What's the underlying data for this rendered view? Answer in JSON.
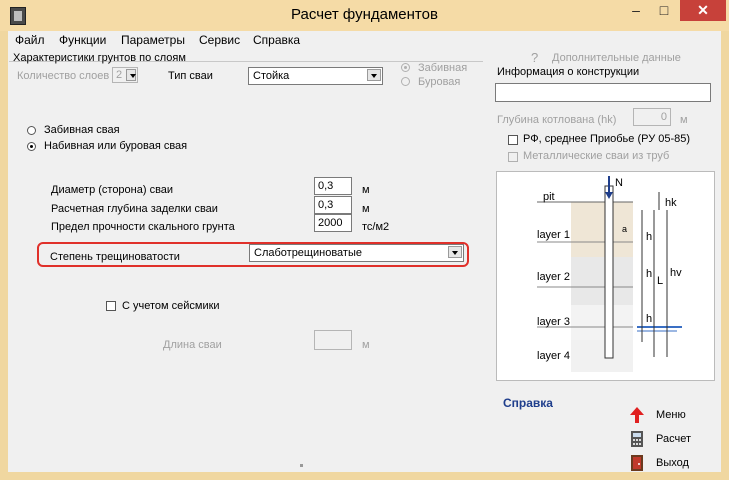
{
  "window": {
    "title": "Расчет фундаментов",
    "min_glyph": "–",
    "max_glyph": "□",
    "close_glyph": "✕"
  },
  "menu": [
    "Файл",
    "Функции",
    "Параметры",
    "Сервис",
    "Справка"
  ],
  "soil": {
    "group_title": "Характеристики грунтов по слоям",
    "layers_label": "Количество слоев",
    "layers_value": "2",
    "pile_type_label": "Тип сваи",
    "pile_type_value": "Стойка",
    "opt_driven": "Забивная",
    "opt_bored": "Буровая"
  },
  "pile_kind": {
    "driven": "Забивная свая",
    "bored": "Набивная или буровая свая"
  },
  "params": {
    "diameter_label": "Диаметр (сторона) сваи",
    "diameter_value": "0,3",
    "diameter_unit": "м",
    "depth_label": "Расчетная глубина заделки сваи",
    "depth_value": "0,3",
    "depth_unit": "м",
    "strength_label": "Предел прочности скального грунта",
    "strength_value": "2000",
    "strength_unit": "тс/м2",
    "fracture_label": "Степень трещиноватости",
    "fracture_value": "Слаботрещиноватые",
    "seismic_label": "С учетом сейсмики",
    "length_label": "Длина сваи",
    "length_value": "",
    "length_unit": "м"
  },
  "right": {
    "additional_label": "Дополнительные данные",
    "info_label": "Информация о конструкции",
    "info_value": "",
    "pit_depth_label": "Глубина котлована (hk)",
    "pit_depth_value": "0",
    "pit_depth_unit": "м",
    "rf_label": "РФ, среднее Приобье (РУ 05-85)",
    "metal_label": "Металлические сваи из труб"
  },
  "diagram": {
    "pit": "pit",
    "layer1": "layer 1",
    "layer2": "layer 2",
    "layer3": "layer 3",
    "layer4": "layer 4",
    "n": "N",
    "hk": "hk",
    "h": "h",
    "l": "L",
    "hv": "hv",
    "a": "a"
  },
  "side": {
    "help": "Справка",
    "menu": "Меню",
    "calc": "Расчет",
    "exit": "Выход"
  },
  "colors": {
    "highlight": "#e0302a",
    "title_bg": "#f5dba6",
    "link": "#1f3e8c",
    "water": "#3a6fc4"
  }
}
